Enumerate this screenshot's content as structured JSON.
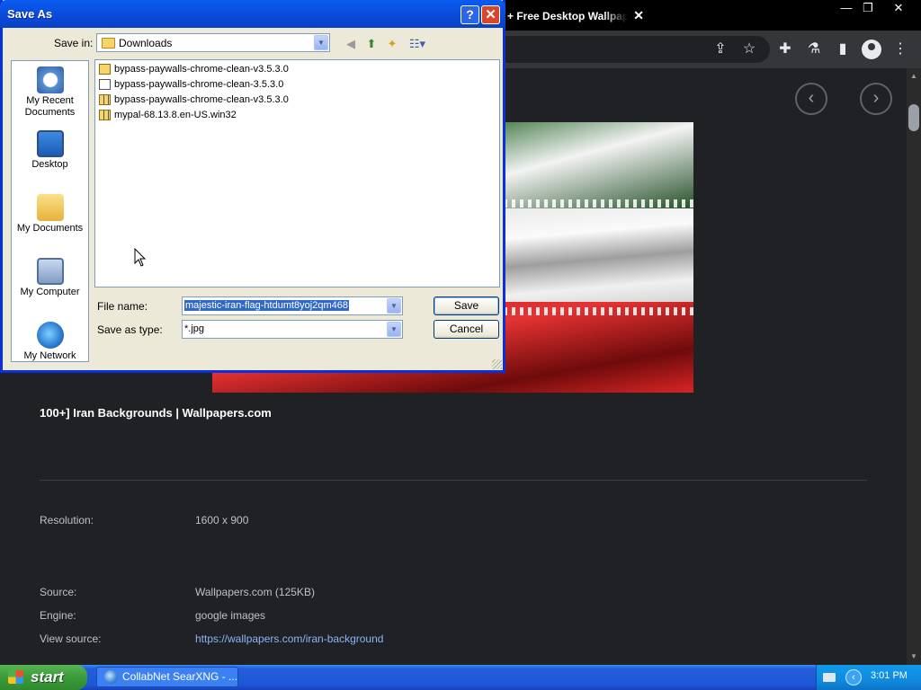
{
  "browser": {
    "tab_title": "+ Free Desktop Wallpaper",
    "tab_close": "✕",
    "window_controls": {
      "minimize": "—",
      "restore": "❐",
      "close": "✕"
    },
    "toolbar_icons": {
      "share": "⇪",
      "bookmark": "☆",
      "extensions": "✚",
      "labs": "⚗",
      "side_panel": "▮",
      "menu": "⋮"
    }
  },
  "page": {
    "prev_label": "‹",
    "next_label": "›",
    "result_title": "100+] Iran Backgrounds | Wallpapers.com",
    "info": [
      {
        "label": "Resolution:",
        "value": "1600 x 900"
      },
      {
        "label": "Source:",
        "value": "Wallpapers.com (125KB)"
      },
      {
        "label": "Engine:",
        "value": "google images"
      },
      {
        "label": "View source:",
        "value": "https://wallpapers.com/iran-background"
      }
    ]
  },
  "dialog": {
    "title": "Save As",
    "help": "?",
    "close": "✕",
    "save_in_label": "Save in:",
    "save_in_value": "Downloads",
    "places": [
      "My Recent Documents",
      "Desktop",
      "My Documents",
      "My Computer",
      "My Network"
    ],
    "files": [
      {
        "name": "bypass-paywalls-chrome-clean-v3.5.3.0",
        "kind": "folder"
      },
      {
        "name": "bypass-paywalls-chrome-clean-3.5.3.0",
        "kind": "exe"
      },
      {
        "name": "bypass-paywalls-chrome-clean-v3.5.3.0",
        "kind": "zip"
      },
      {
        "name": "mypal-68.13.8.en-US.win32",
        "kind": "zip"
      }
    ],
    "file_name_label": "File name:",
    "file_name_value": "majestic-iran-flag-htdumt8yoj2qm468",
    "save_type_label": "Save as type:",
    "save_type_value": "*.jpg",
    "save_button": "Save",
    "cancel_button": "Cancel"
  },
  "taskbar": {
    "start_label": "start",
    "task_label": "CollabNet SearXNG - ...",
    "clock": "3:01 PM"
  },
  "colors": {
    "xp_blue": "#0a5cf0",
    "xp_green": "#3c9a3a",
    "link": "#8ab4f8",
    "page_bg": "#202124"
  }
}
